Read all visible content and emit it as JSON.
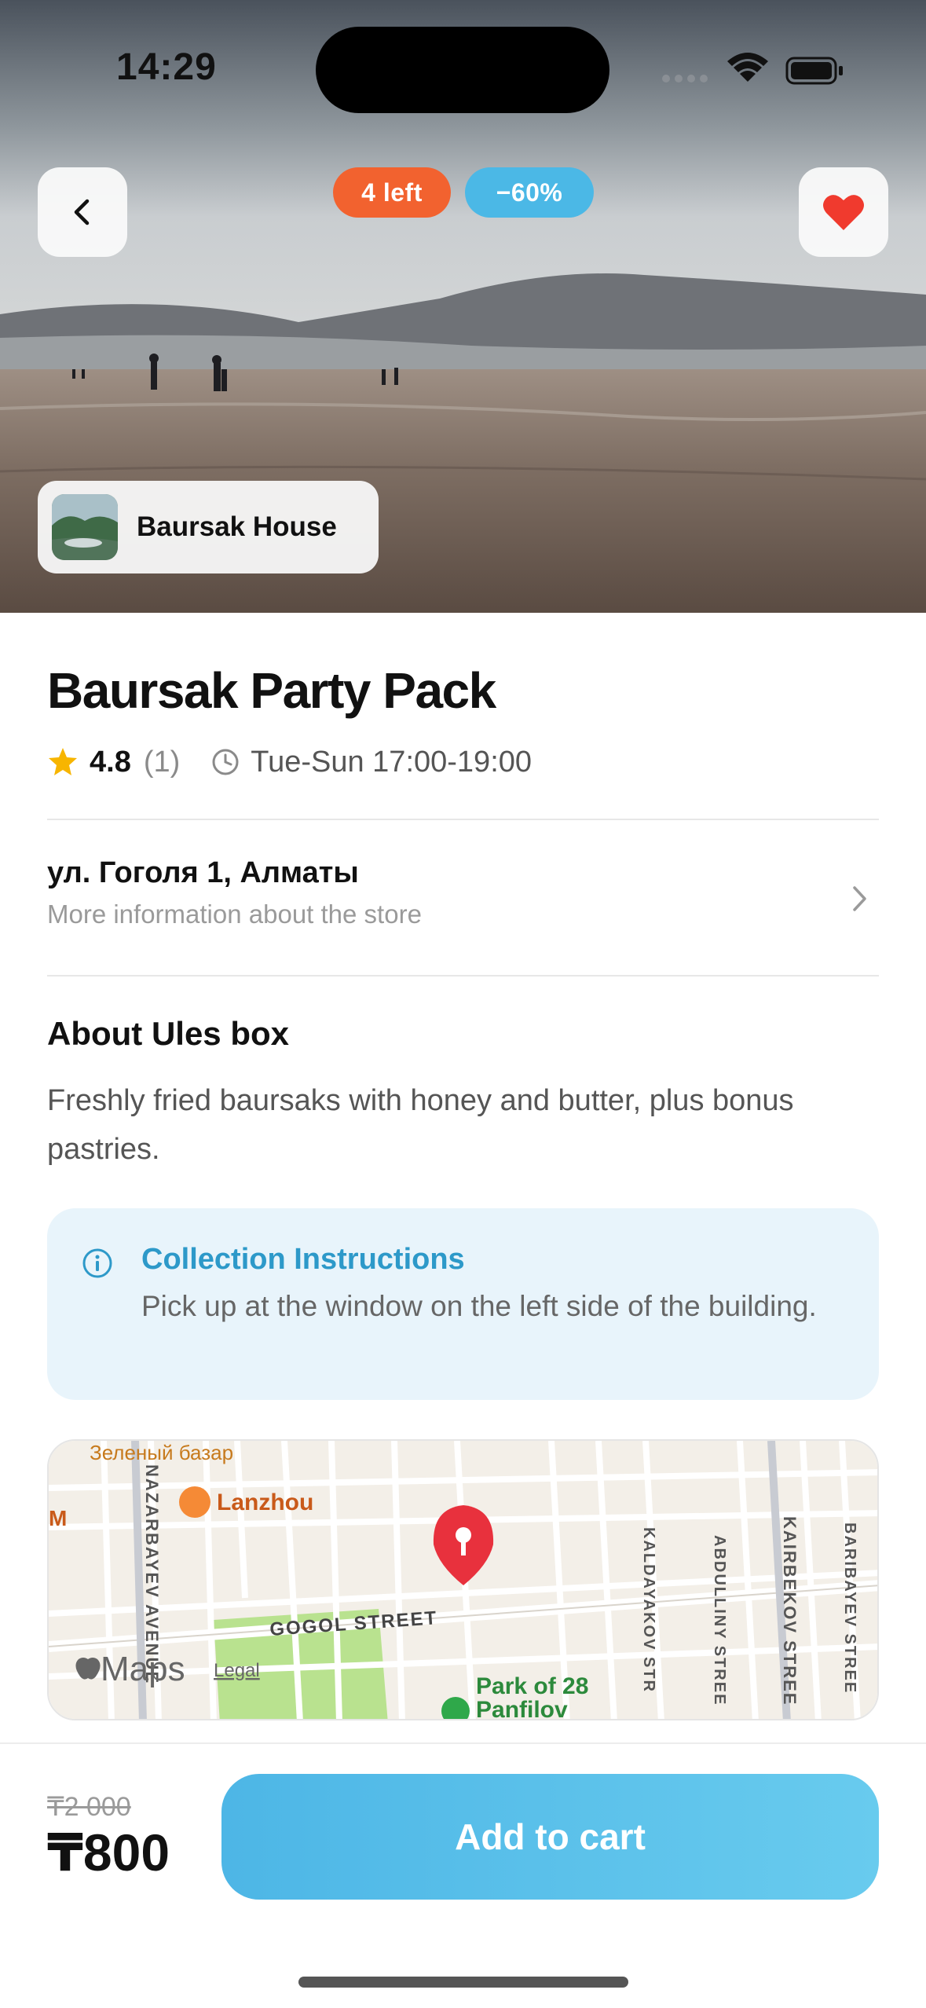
{
  "status_bar": {
    "time": "14:29"
  },
  "hero": {
    "badge_left": "4 left",
    "badge_discount": "−60%",
    "store_name": "Baursak House",
    "colors": {
      "badge_left": "#f2622f",
      "badge_discount": "#4bb8e6",
      "heart": "#f03a2e"
    }
  },
  "product": {
    "title": "Baursak Party Pack",
    "rating": "4.8",
    "rating_count": "(1)",
    "hours": "Tue-Sun 17:00-19:00"
  },
  "store": {
    "address": "ул. Гоголя 1, Алматы",
    "more_info": "More information about the store"
  },
  "about": {
    "title": "About Ules box",
    "text": "Freshly fried baursaks with honey and butter, plus bonus pastries."
  },
  "collection": {
    "title": "Collection Instructions",
    "text": "Pick up at the window on the left side of the building."
  },
  "map": {
    "labels": {
      "lanzhou": "Lanzhou",
      "top_place": "Зеленый базар",
      "gogol": "GOGOL STREET",
      "nazarbayev": "NAZARBAYEV AVENUE",
      "kaldayakov": "KALDAYAKOV STR",
      "abdulliny": "ABDULLINY STREE",
      "kairbekov": "KAIRBEKOV STREE",
      "baribayev": "BARIBAYEV STREE",
      "park": "Park of 28",
      "park2": "Panfilov",
      "edge_letter": "M",
      "maps_brand": "Maps",
      "legal": "Legal"
    },
    "colors": {
      "park": "#b9e28f",
      "pin": "#e8313d"
    }
  },
  "checkout": {
    "old_price": "₸2 000",
    "price": "₸800",
    "button": "Add to cart"
  }
}
